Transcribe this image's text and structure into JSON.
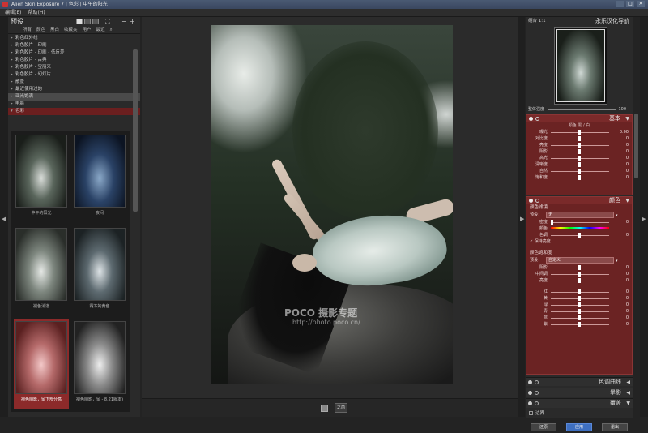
{
  "window": {
    "title": "Alien Skin Exposure 7 | 色彩 | 中午的阳光",
    "min": "_",
    "max": "□",
    "close": "×"
  },
  "menu": [
    "编辑(E)",
    "帮助(H)"
  ],
  "left": {
    "title": "预设",
    "tabs": [
      "所有",
      "颜色",
      "黑白",
      "收藏夹",
      "用户",
      "最近"
    ],
    "tree": [
      "彩色红外线",
      "彩色胶片 - 印刷",
      "彩色胶片 - 印刷 - 低反差",
      "彩色胶片 - 古典",
      "彩色胶片 - 宝丽来",
      "彩色胶片 - 幻灯片",
      "散景",
      "最近使用过的",
      "亚光饱满",
      "电影",
      "色彩"
    ],
    "thumbs": [
      "中午的阳光",
      "夜间",
      "褪色消逝",
      "霜冻的黄色",
      "褪色阴影，留下部分高",
      "褪色阴影，留 - 8.21版本)"
    ]
  },
  "center": {
    "watermark": "POCO 摄影专题",
    "watermark_url": "http://photo.poco.cn/",
    "before_label": "之前"
  },
  "right": {
    "header_left": "缩合 1:1",
    "header_right": "永乐汉化导航",
    "opacity_label": "整体强度",
    "opacity_value": "100",
    "basic": {
      "title": "基本",
      "subtabs": "颜色   黑 / 白",
      "rows": [
        {
          "label": "曝光",
          "value": "0.00"
        },
        {
          "label": "对比度",
          "value": "0"
        },
        {
          "label": "亮度",
          "value": "0"
        },
        {
          "label": "阴影",
          "value": "0"
        },
        {
          "label": "高光",
          "value": "0"
        },
        {
          "label": "清晰度",
          "value": "0"
        },
        {
          "label": "自然",
          "value": "0"
        },
        {
          "label": "饱和度",
          "value": "0"
        }
      ]
    },
    "color": {
      "title": "颜色",
      "filter_title": "颜色滤镜",
      "preset_label": "预设：",
      "preset_value": "无",
      "density_label": "密度",
      "density_value": "0",
      "hue_label": "颜色",
      "tone_label": "色调",
      "tone_value": "0",
      "keep_bright": "保持亮度",
      "sat_title": "颜色饱和度",
      "sat_preset_value": "自定义",
      "sat_rows": [
        {
          "label": "阴影",
          "value": "0"
        },
        {
          "label": "中间调",
          "value": "0"
        },
        {
          "label": "亮度",
          "value": "0"
        },
        {
          "label": "红",
          "value": "0"
        },
        {
          "label": "黄",
          "value": "0"
        },
        {
          "label": "绿",
          "value": "0"
        },
        {
          "label": "青",
          "value": "0"
        },
        {
          "label": "蓝",
          "value": "0"
        },
        {
          "label": "紫",
          "value": "0"
        }
      ]
    },
    "collapsed": [
      "色调曲线",
      "晕影",
      "覆盖"
    ],
    "bounds_label": "边界",
    "buttons": [
      "还原",
      "应用",
      "退出"
    ]
  },
  "colors": {
    "accent": "#6b2323",
    "primary_button": "#3e6fc0"
  }
}
